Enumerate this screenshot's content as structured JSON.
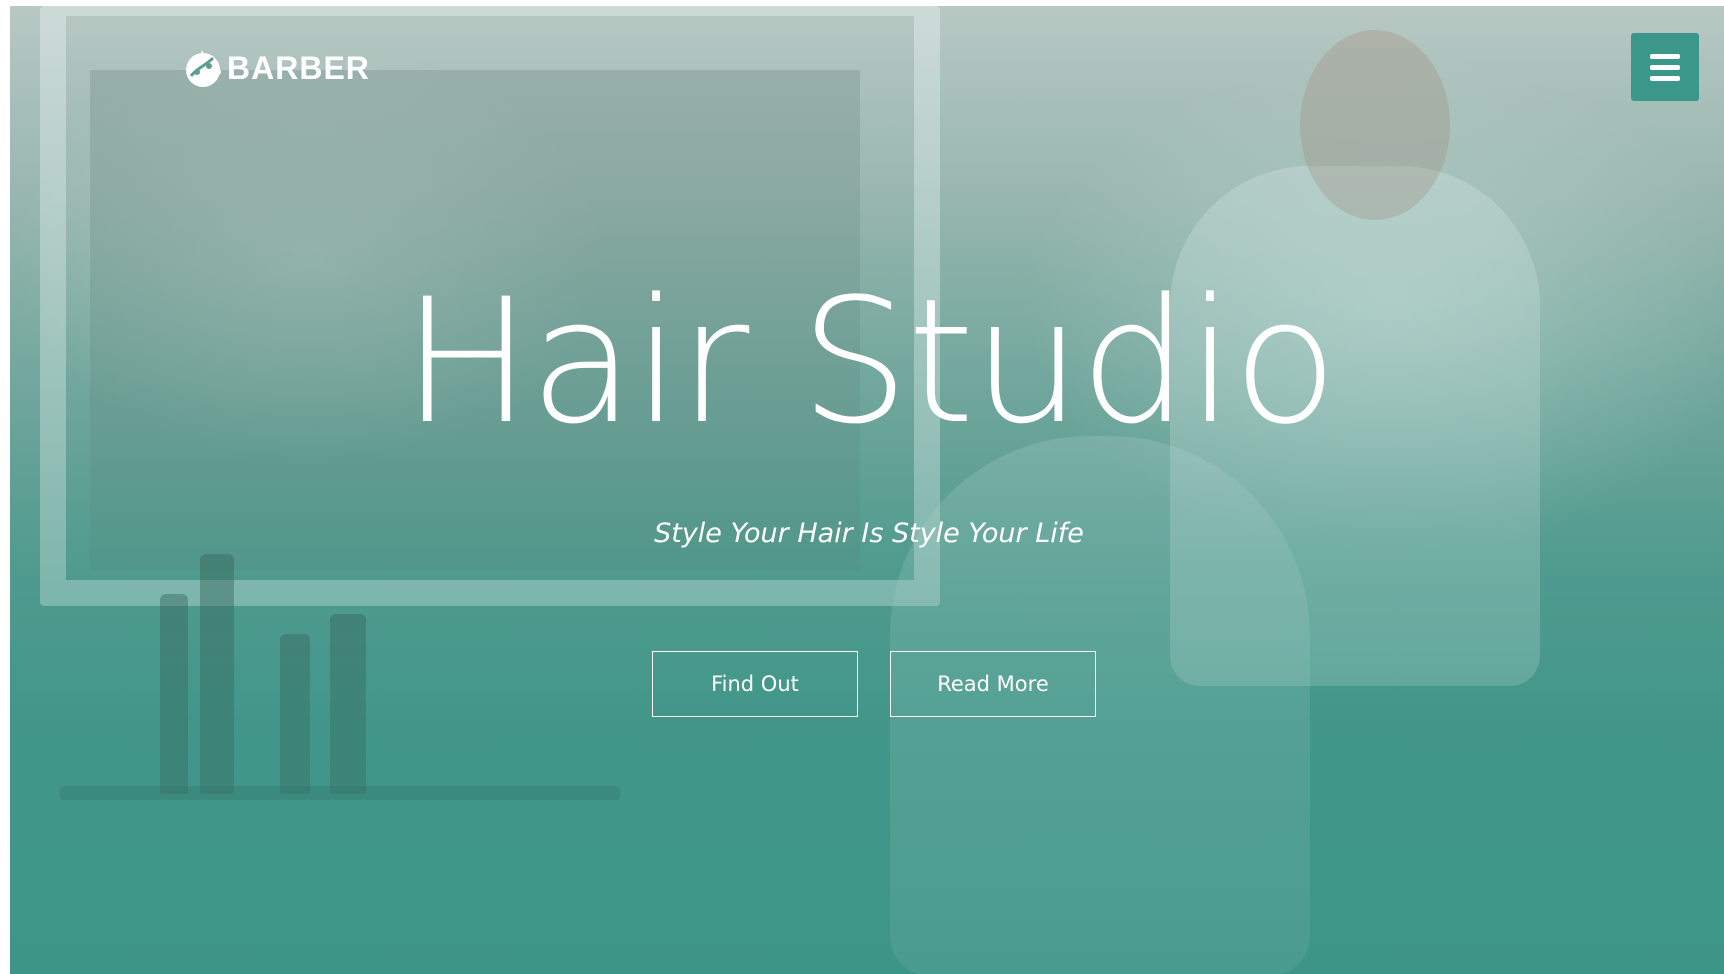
{
  "brand": {
    "logo_text": "BARBER",
    "logo_icon": "barber-logo-icon"
  },
  "header": {
    "menu_icon": "hamburger-menu-icon",
    "menu_color": "#3a978a"
  },
  "hero": {
    "title": "Hair Studio",
    "subtitle": "Style Your Hair Is Style Your Life",
    "buttons": {
      "find_out": "Find Out",
      "read_more": "Read More"
    },
    "accent_color": "#3f9487"
  }
}
